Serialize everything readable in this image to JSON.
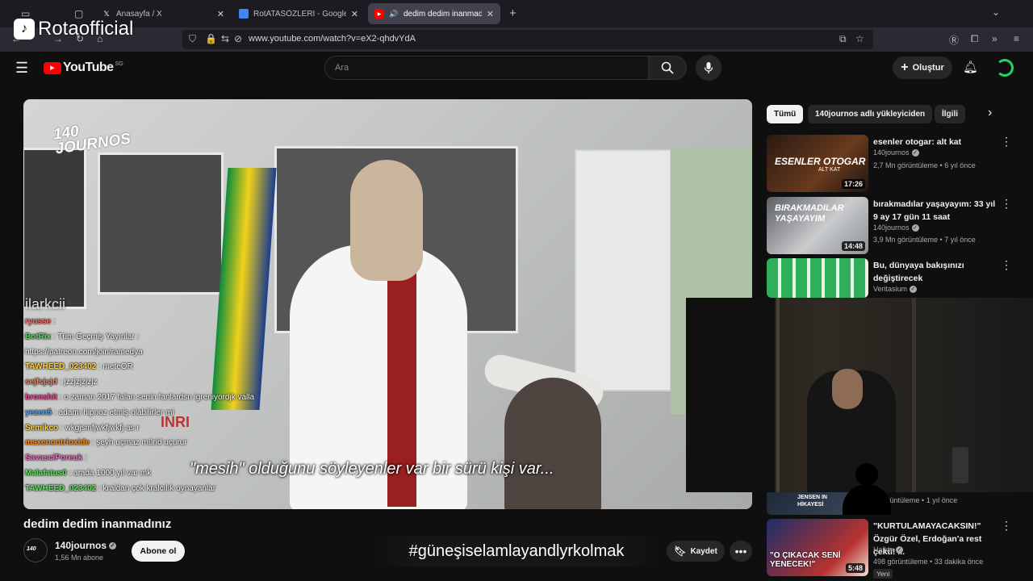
{
  "browser": {
    "tabs": [
      {
        "title": "Anasayfa / X",
        "icon": "x-icon"
      },
      {
        "title": "RotATASÖZLERİ - Google Doküm",
        "icon": "docs-icon"
      },
      {
        "title": "dedim dedim inanmadınız -",
        "icon": "youtube-icon"
      }
    ],
    "url": "www.youtube.com/watch?v=eX2-qhdvYdA"
  },
  "watermark": {
    "text": "Rotaofficial"
  },
  "youtube": {
    "logo_text": "YouTube",
    "region": "SG",
    "search_placeholder": "Ara",
    "create_label": "Oluştur"
  },
  "video": {
    "title": "dedim dedim inanmadınız",
    "channel": "140journos",
    "subscribers": "1,56 Mn abone",
    "subscribe_label": "Abone ol",
    "save_label": "Kaydet",
    "watermark_logo": "140 JOURNOS",
    "subtitle": "\"mesih\" olduğunu söyleyenler var bir sürü kişi var...",
    "hashtag": "#güneşiselamlayandlyrkolmak",
    "sign_text": "INRI",
    "streamer_name": "ilarkcii"
  },
  "chat": [
    {
      "user": "ryusse",
      "message": ""
    },
    {
      "user": "BotRix",
      "message": "Tüm Geçmiş Yayınlar :"
    },
    {
      "user": "",
      "message": "https://patreon.com/join/ramedya"
    },
    {
      "user": "TAWHEED_023402",
      "message": "meteOR"
    },
    {
      "user": "sejfsjsjd",
      "message": "jzzjzjzjzjz"
    },
    {
      "user": "bronshit",
      "message": "o zaman 2017 falan senin fanlardsn igreniyordjk valla"
    },
    {
      "user": "yezen5",
      "message": "adamı hipnoz etmiş olabilirler mi"
    },
    {
      "user": "Semikco",
      "message": "wkgjsmfjwkfjwkfj as r"
    },
    {
      "user": "msxenontrioxide",
      "message": "şeyh uçmaz mürid uçurur"
    },
    {
      "user": "SavasciPoreuk",
      "message": ""
    },
    {
      "user": "Malafatus0",
      "message": "arada 1000 yıl var mk"
    },
    {
      "user": "TAWHEED_023402",
      "message": "kraldan çok kralcılık oynayanlar"
    }
  ],
  "chips": [
    "Tümü",
    "140journos adlı yükleyiciden",
    "İlgili"
  ],
  "recommendations": [
    {
      "title": "esenler otogar: alt kat",
      "channel": "140journos",
      "meta": "2,7 Mn görüntüleme • 6 yıl önce",
      "duration": "17:26",
      "thumb_text": "ESENLER OTOGAR",
      "thumb_sub": "ALT KAT"
    },
    {
      "title": "bırakmadılar yaşayayım: 33 yıl 9 ay 17 gün 11 saat",
      "channel": "140journos",
      "meta": "3,9 Mn görüntüleme • 7 yıl önce",
      "duration": "14:48",
      "thumb_text": "BIRAKMADILAR YAŞAYAYIM"
    },
    {
      "title": "Bu, dünyaya bakışınızı değiştirecek",
      "channel": "Veritasium",
      "meta": "",
      "duration": ""
    },
    {
      "title": "",
      "channel": "",
      "meta": "n görüntüleme • 1 yıl önce",
      "duration": "",
      "thumb_text": "JENSEN IN HİKAYESİ"
    },
    {
      "title": "\"KURTULAMAYACAKSIN!\" Özgür Özel, Erdoğan'a rest çekti! ...",
      "channel": "Halktv",
      "meta": "498 görüntüleme • 33 dakika önce",
      "badge": "Yeni",
      "duration": "5:48",
      "thumb_text": "\"O ÇIKACAK SENİ YENECEK!\""
    }
  ]
}
